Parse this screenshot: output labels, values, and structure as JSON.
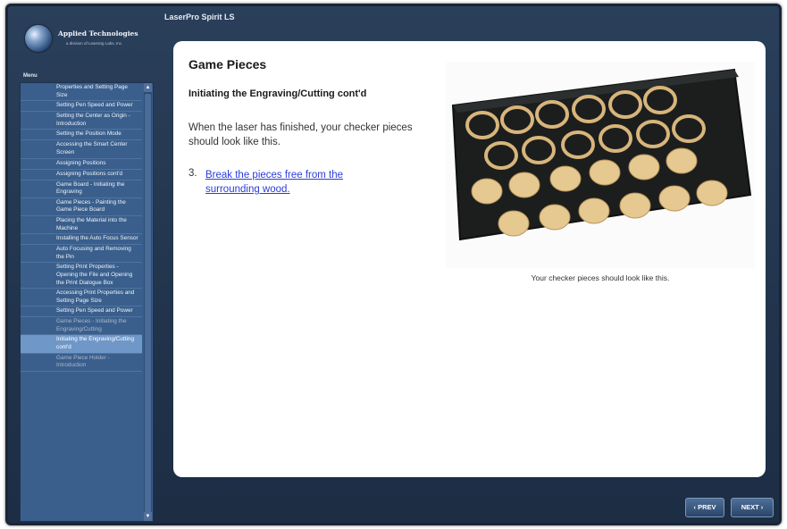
{
  "app": {
    "title": "LaserPro Spirit LS",
    "brand_name": "Applied Technologies",
    "brand_sub": "a division of Learning Labs, Inc."
  },
  "sidebar": {
    "menu_label": "Menu",
    "items": [
      {
        "label": "Properties and Setting Page Size",
        "state": "normal"
      },
      {
        "label": "Setting Pen Speed and Power",
        "state": "normal"
      },
      {
        "label": "Setting the Center as Origin - Introduction",
        "state": "normal"
      },
      {
        "label": "Setting the Position Mode",
        "state": "normal"
      },
      {
        "label": "Accessing the Smart Center Screen",
        "state": "normal"
      },
      {
        "label": "Assigning Positions",
        "state": "normal"
      },
      {
        "label": "Assigning Positions cont'd",
        "state": "normal"
      },
      {
        "label": "Game Board - Initiating the Engraving",
        "state": "normal"
      },
      {
        "label": "Game Pieces - Painting the Game Piece Board",
        "state": "normal"
      },
      {
        "label": "Placing the Material into the Machine",
        "state": "normal"
      },
      {
        "label": "Installing the Auto Focus Sensor",
        "state": "normal"
      },
      {
        "label": "Auto Focusing and Removing the Pin",
        "state": "normal"
      },
      {
        "label": "Setting Print Properties - Opening the File and Opening the Print Dialogue Box",
        "state": "normal"
      },
      {
        "label": "Accessing Print Properties and Setting Page Size",
        "state": "normal"
      },
      {
        "label": "Setting Pen Speed and Power",
        "state": "normal"
      },
      {
        "label": "Game Pieces - Initiating the Engraving/Cutting",
        "state": "dim"
      },
      {
        "label": "Initiating the Engraving/Cutting cont'd",
        "state": "active"
      },
      {
        "label": "Game Piece Holder - Introduction",
        "state": "dim"
      }
    ]
  },
  "content": {
    "title": "Game Pieces",
    "subtitle": "Initiating the Engraving/Cutting cont'd",
    "body": "When the laser has finished, your checker pieces should look like this.",
    "step_number": "3.",
    "step_link": "Break the pieces free from the surrounding wood.",
    "image_caption": "Your checker pieces should look like this."
  },
  "nav": {
    "prev_label": "‹ PREV",
    "next_label": "NEXT ›"
  },
  "colors": {
    "frame": "#223650",
    "sidebar": "#3a5f8d",
    "link": "#2b3cd9",
    "wood": "#e2c48a",
    "board": "#1d1f1f"
  }
}
